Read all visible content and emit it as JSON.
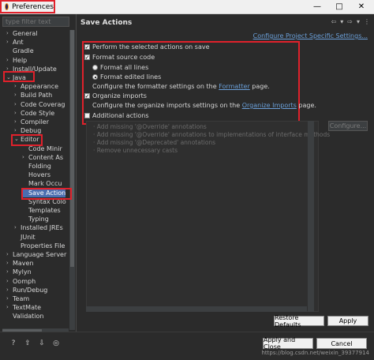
{
  "window": {
    "title": "Preferences",
    "minimize": "—",
    "maximize": "□",
    "close": "✕"
  },
  "sidebar": {
    "filter_placeholder": "type filter text",
    "items": [
      {
        "label": "General",
        "indent": 0,
        "arrow": "›"
      },
      {
        "label": "Ant",
        "indent": 0,
        "arrow": "›"
      },
      {
        "label": "Gradle",
        "indent": 0,
        "arrow": ""
      },
      {
        "label": "Help",
        "indent": 0,
        "arrow": "›"
      },
      {
        "label": "Install/Update",
        "indent": 0,
        "arrow": "›"
      },
      {
        "label": "Java",
        "indent": 0,
        "arrow": "⌄"
      },
      {
        "label": "Appearance",
        "indent": 1,
        "arrow": "›"
      },
      {
        "label": "Build Path",
        "indent": 1,
        "arrow": "›"
      },
      {
        "label": "Code Coverag",
        "indent": 1,
        "arrow": "›"
      },
      {
        "label": "Code Style",
        "indent": 1,
        "arrow": "›"
      },
      {
        "label": "Compiler",
        "indent": 1,
        "arrow": "›"
      },
      {
        "label": "Debug",
        "indent": 1,
        "arrow": "›"
      },
      {
        "label": "Editor",
        "indent": 1,
        "arrow": "⌄"
      },
      {
        "label": "Code Minir",
        "indent": 2,
        "arrow": ""
      },
      {
        "label": "Content As",
        "indent": 2,
        "arrow": "›"
      },
      {
        "label": "Folding",
        "indent": 2,
        "arrow": ""
      },
      {
        "label": "Hovers",
        "indent": 2,
        "arrow": ""
      },
      {
        "label": "Mark Occu",
        "indent": 2,
        "arrow": ""
      },
      {
        "label": "Save Action",
        "indent": 2,
        "arrow": "",
        "selected": true
      },
      {
        "label": "Syntax Colo",
        "indent": 2,
        "arrow": ""
      },
      {
        "label": "Templates",
        "indent": 2,
        "arrow": ""
      },
      {
        "label": "Typing",
        "indent": 2,
        "arrow": ""
      },
      {
        "label": "Installed JREs",
        "indent": 1,
        "arrow": "›"
      },
      {
        "label": "JUnit",
        "indent": 1,
        "arrow": ""
      },
      {
        "label": "Properties File",
        "indent": 1,
        "arrow": ""
      },
      {
        "label": "Language Server",
        "indent": 0,
        "arrow": "›"
      },
      {
        "label": "Maven",
        "indent": 0,
        "arrow": "›"
      },
      {
        "label": "Mylyn",
        "indent": 0,
        "arrow": "›"
      },
      {
        "label": "Oomph",
        "indent": 0,
        "arrow": "›"
      },
      {
        "label": "Run/Debug",
        "indent": 0,
        "arrow": "›"
      },
      {
        "label": "Team",
        "indent": 0,
        "arrow": "›"
      },
      {
        "label": "TextMate",
        "indent": 0,
        "arrow": "›"
      },
      {
        "label": "Validation",
        "indent": 0,
        "arrow": ""
      }
    ]
  },
  "main": {
    "title": "Save Actions",
    "nav": {
      "back": "⇦",
      "back_menu": "▾",
      "forward": "⇨",
      "forward_menu": "▾",
      "menu": "⋮"
    },
    "configure_link": "Configure Project Specific Settings...",
    "perform_label": "Perform the selected actions on save",
    "perform_checked": true,
    "format_label": "Format source code",
    "format_checked": true,
    "format_all_label": "Format all lines",
    "format_all_selected": false,
    "format_edited_label": "Format edited lines",
    "format_edited_selected": true,
    "formatter_text_prefix": "Configure the formatter settings on the",
    "formatter_link": "Formatter",
    "formatter_text_suffix": "page.",
    "organize_label": "Organize imports",
    "organize_checked": true,
    "organize_text_prefix": "Configure the organize imports settings on the",
    "organize_link": "Organize Imports",
    "organize_text_suffix": "page.",
    "additional_label": "Additional actions",
    "additional_checked": false,
    "additional_items": [
      "· Add missing '@Override' annotations",
      "· Add missing '@Override' annotations to implementations of interface methods",
      "· Add missing '@Deprecated' annotations",
      "· Remove unnecessary casts"
    ],
    "configure_button": "Configure...",
    "restore_button": "Restore Defaults",
    "apply_button": "Apply"
  },
  "footer": {
    "help_icon": "?",
    "import_icon": "⇧",
    "export_icon": "⇩",
    "oomph_icon": "◎",
    "apply_close_button": "Apply and Close",
    "cancel_button": "Cancel",
    "watermark": "https://blog.csdn.net/weixin_39377914"
  },
  "colors": {
    "accent_red": "#e0212b",
    "link": "#6a9fd8",
    "selection": "#4b6eaf"
  }
}
